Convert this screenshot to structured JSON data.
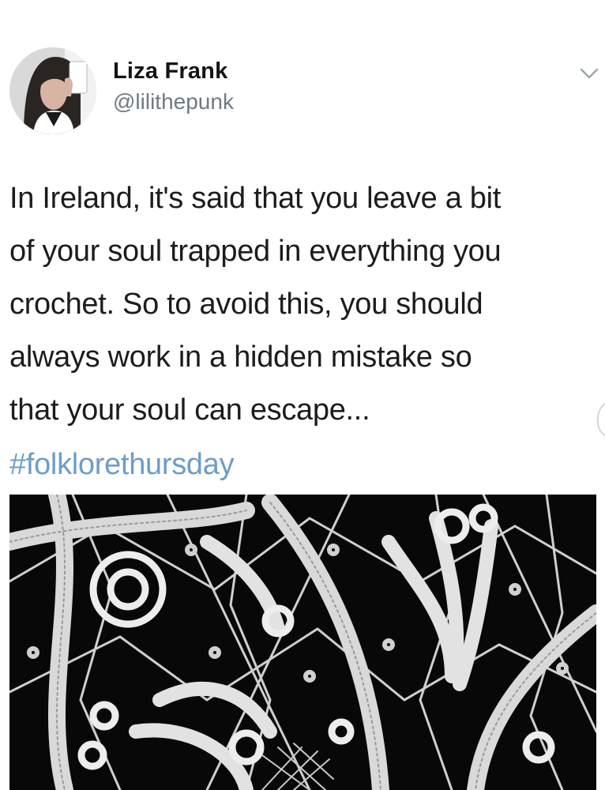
{
  "tweet": {
    "author": {
      "display_name": "Liza Frank",
      "handle": "@lilithepunk",
      "avatar_icon": "profile-photo"
    },
    "menu_icon": "chevron-down-icon",
    "text_lines": [
      "In Ireland, it's said that you leave a bit",
      "of your soul trapped in everything you",
      "crochet. So to avoid this, you should",
      "always work in a hidden mistake so",
      "that your soul can escape..."
    ],
    "hashtag": "#folklorethursday",
    "media": {
      "kind": "photo",
      "subject": "crochet-lace-photo"
    }
  },
  "colors": {
    "name": "#141414",
    "handle": "#6f7a84",
    "body_text": "#1c1c1c",
    "hashtag": "#6d9cc9",
    "media_background": "#080808",
    "lace": "#e6e6e6"
  }
}
